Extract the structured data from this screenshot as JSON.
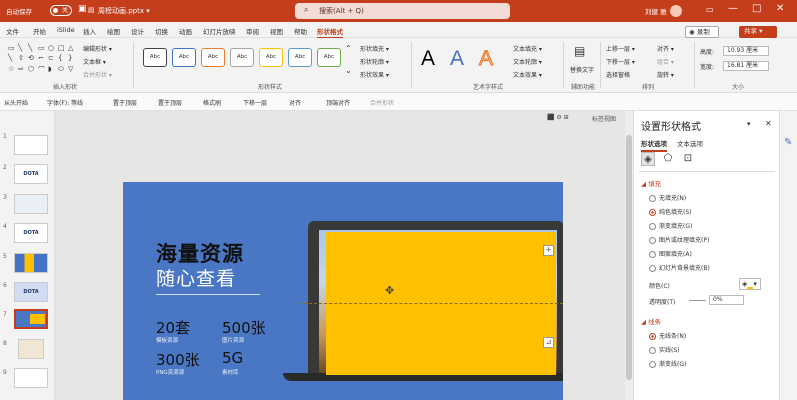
{
  "titlebar": {
    "autosave": "自动保存",
    "toggle": "关",
    "filename": "周榜动画.pptx ▾",
    "search": "搜索(Alt + Q)",
    "user": "刘健 雅",
    "min": "—",
    "max": "□",
    "close": "✕"
  },
  "menu": {
    "items": [
      "文件",
      "开始",
      "iSlide",
      "插入",
      "绘图",
      "设计",
      "切换",
      "动画",
      "幻灯片放映",
      "审阅",
      "视图",
      "帮助",
      "形状格式"
    ],
    "record": "◉ 录制",
    "share": "共享 ▾"
  },
  "ribbon": {
    "insert_shape": {
      "edit_shape": "编辑形状 ▾",
      "textbox": "文本框 ▾",
      "merge_shapes": "合并形状 ▾",
      "label": "插入形状",
      "shapes": [
        "▭",
        "╲",
        "╲",
        "▭",
        "○",
        "□",
        "△",
        "╲",
        "⇧",
        "⟲",
        "⌐",
        "⊂",
        "{",
        "}",
        "☆",
        "⇨",
        "⬡",
        "⌒",
        "◗",
        "⬭",
        "▽",
        "⟨",
        "◇",
        "⬠",
        "⌓",
        "⬯",
        "⯃",
        "▷"
      ]
    },
    "shape_styles": {
      "sample": "Abc",
      "fill": "形状填充 ▾",
      "outline": "形状轮廓 ▾",
      "effect": "形状效果 ▾",
      "label": "形状样式"
    },
    "wordart": {
      "letters": [
        "A",
        "A",
        "A"
      ],
      "fill": "文本填充 ▾",
      "outline": "文本轮廓 ▾",
      "effect": "文本效果 ▾",
      "label": "艺术字样式"
    },
    "accessibility": {
      "alt_text": "替换文字",
      "label": "辅助功能"
    },
    "arrange": {
      "forward": "上移一层 ▾",
      "backward": "下移一层 ▾",
      "pane": "选择窗格",
      "align": "对齐 ▾",
      "group": "组合 ▾",
      "rotate": "旋转 ▾",
      "label": "排列"
    },
    "size": {
      "height_label": "高度:",
      "height": "10.93 厘米",
      "width_label": "宽度:",
      "width": "16.81 厘米",
      "label": "大小"
    }
  },
  "formatbar": {
    "from_start": "从头开始",
    "font": "字体(F): 等线",
    "top": "置于顶层",
    "to_front": "置于顶层",
    "painter": "格式刷",
    "send_back": "下移一层",
    "align": "对齐",
    "align_top": "顶端对齐",
    "group": "合并形状"
  },
  "slides": [
    {
      "num": "1",
      "label": ""
    },
    {
      "num": "2",
      "label": "DOTA"
    },
    {
      "num": "3",
      "label": ""
    },
    {
      "num": "4",
      "label": "DOTA"
    },
    {
      "num": "5",
      "label": ""
    },
    {
      "num": "6",
      "label": "DOTA"
    },
    {
      "num": "7",
      "label": ""
    },
    {
      "num": "8",
      "label": ""
    },
    {
      "num": "9",
      "label": ""
    }
  ],
  "slide": {
    "h1": "海量资源",
    "h2": "随心查看",
    "stats": [
      {
        "value": "20套",
        "label": "模板资源"
      },
      {
        "value": "500张",
        "label": "图片资源"
      },
      {
        "value": "300张",
        "label": "PNG资源源"
      },
      {
        "value": "5G",
        "label": "素材库"
      }
    ]
  },
  "canvas_tools": {
    "note": "标签视图",
    "icons": "⬛ ⚙ ⊞"
  },
  "panel": {
    "title": "设置形状格式",
    "close": "✕",
    "dropdown": "▾",
    "tabs": {
      "shape": "形状选项",
      "text": "文本选项"
    },
    "fill_section": "◢ 填充",
    "fill_options": [
      "无填充(N)",
      "纯色填充(S)",
      "渐变填充(G)",
      "图片或纹理填充(P)",
      "图案填充(A)",
      "幻灯片背景填充(B)"
    ],
    "color_label": "颜色(C)",
    "transparency_label": "透明度(T)",
    "transparency": "0%",
    "line_section": "◢ 线条",
    "line_options": [
      "无线条(N)",
      "实线(S)",
      "渐变线(G)"
    ]
  },
  "colors": {
    "accent": "#c43e1c",
    "slide_bg": "#4a77c4",
    "yellow": "#ffc000"
  }
}
